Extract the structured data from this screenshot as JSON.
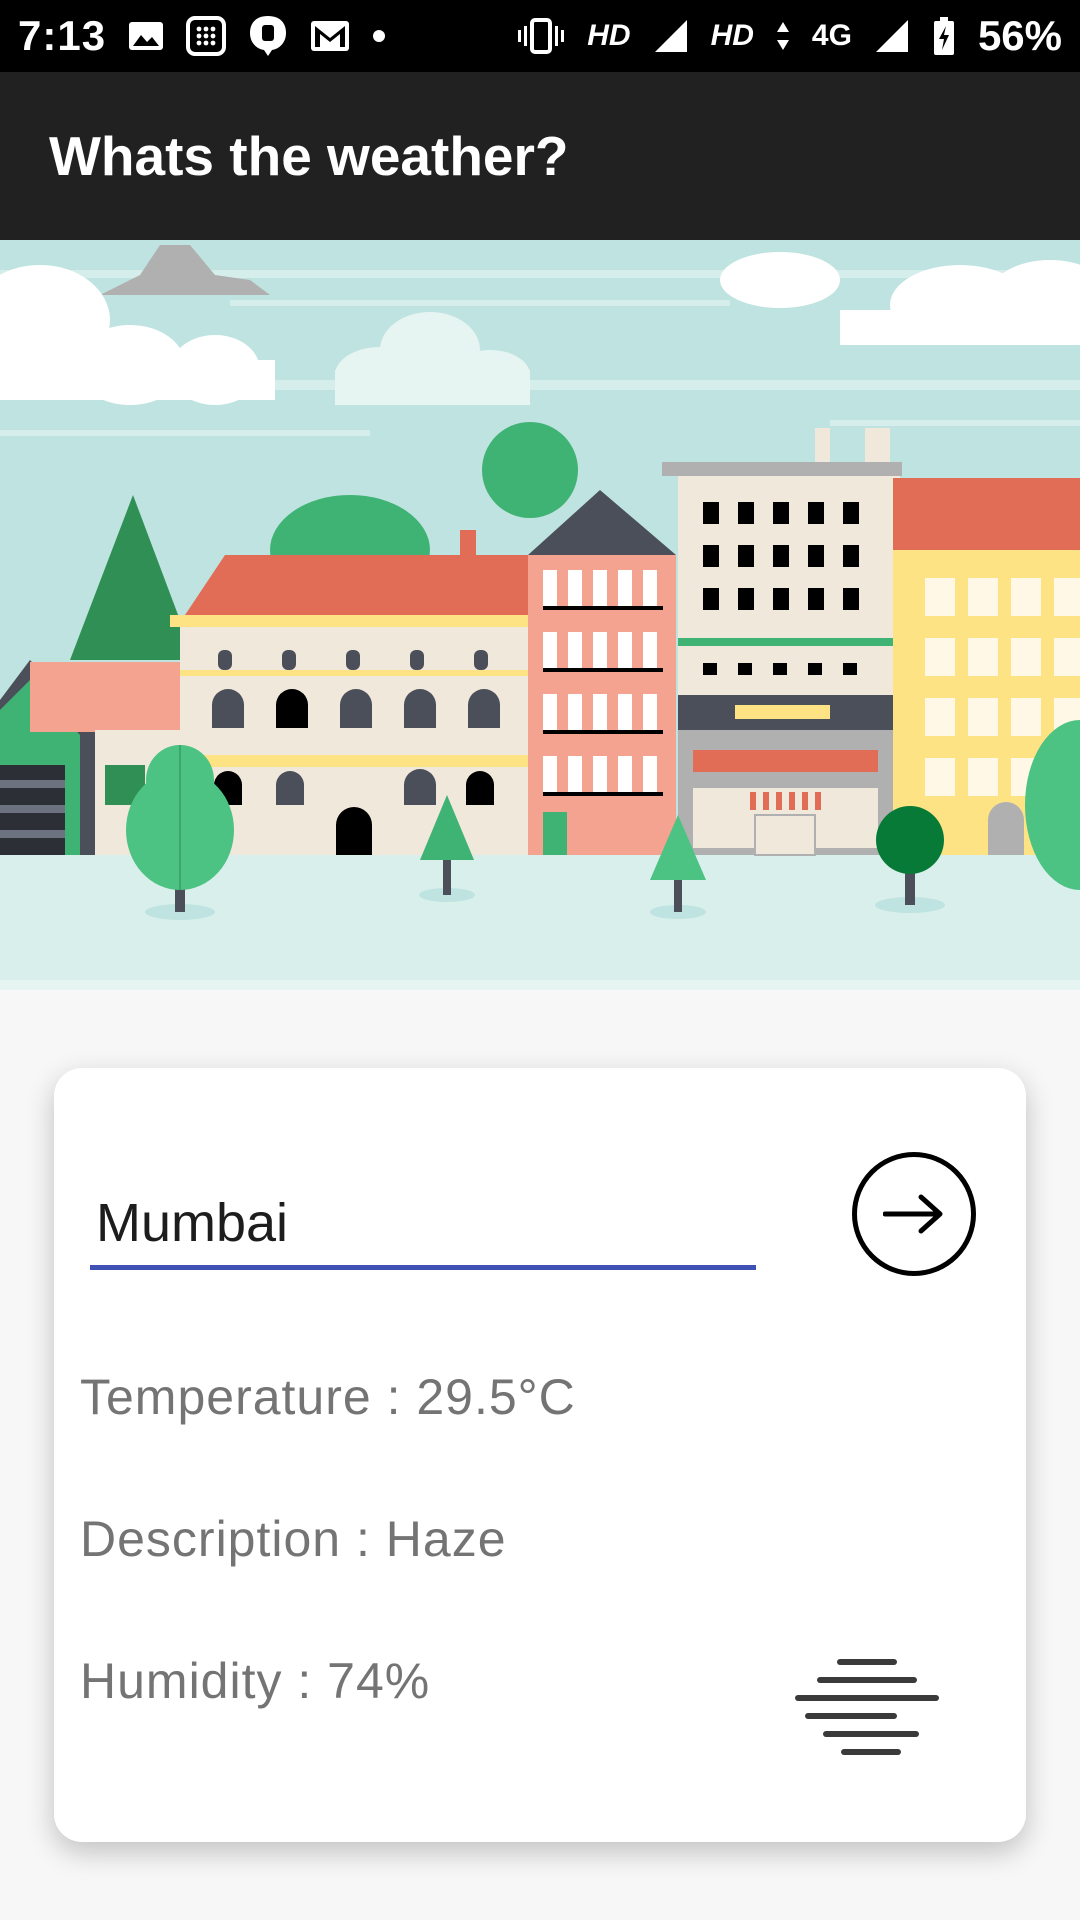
{
  "status_bar": {
    "time": "7:13",
    "hd1": "HD",
    "hd2": "HD",
    "network": "4G",
    "battery_percent": "56%",
    "left_icons": [
      "image-icon",
      "calculator-icon",
      "message-icon",
      "gmail-icon",
      "dot-icon"
    ],
    "right_icons": [
      "vibrate-icon",
      "signal-icon",
      "data-arrows-icon",
      "signal-icon",
      "battery-charging-icon"
    ]
  },
  "app_bar": {
    "title": "Whats the weather?"
  },
  "hero": {
    "description_icon": "city-illustration"
  },
  "card": {
    "city_input": {
      "value": "Mumbai",
      "placeholder": ""
    },
    "go_button_icon": "arrow-right-icon",
    "temperature_text": "Temperature : 29.5°C",
    "description_text": "Description : Haze",
    "humidity_text": "Humidity : 74%",
    "weather_icon": "haze-icon"
  },
  "colors": {
    "app_bar": "#212121",
    "accent_underline": "#3f51b5",
    "info_text": "#747474",
    "page_bg": "#f7f7f7"
  }
}
